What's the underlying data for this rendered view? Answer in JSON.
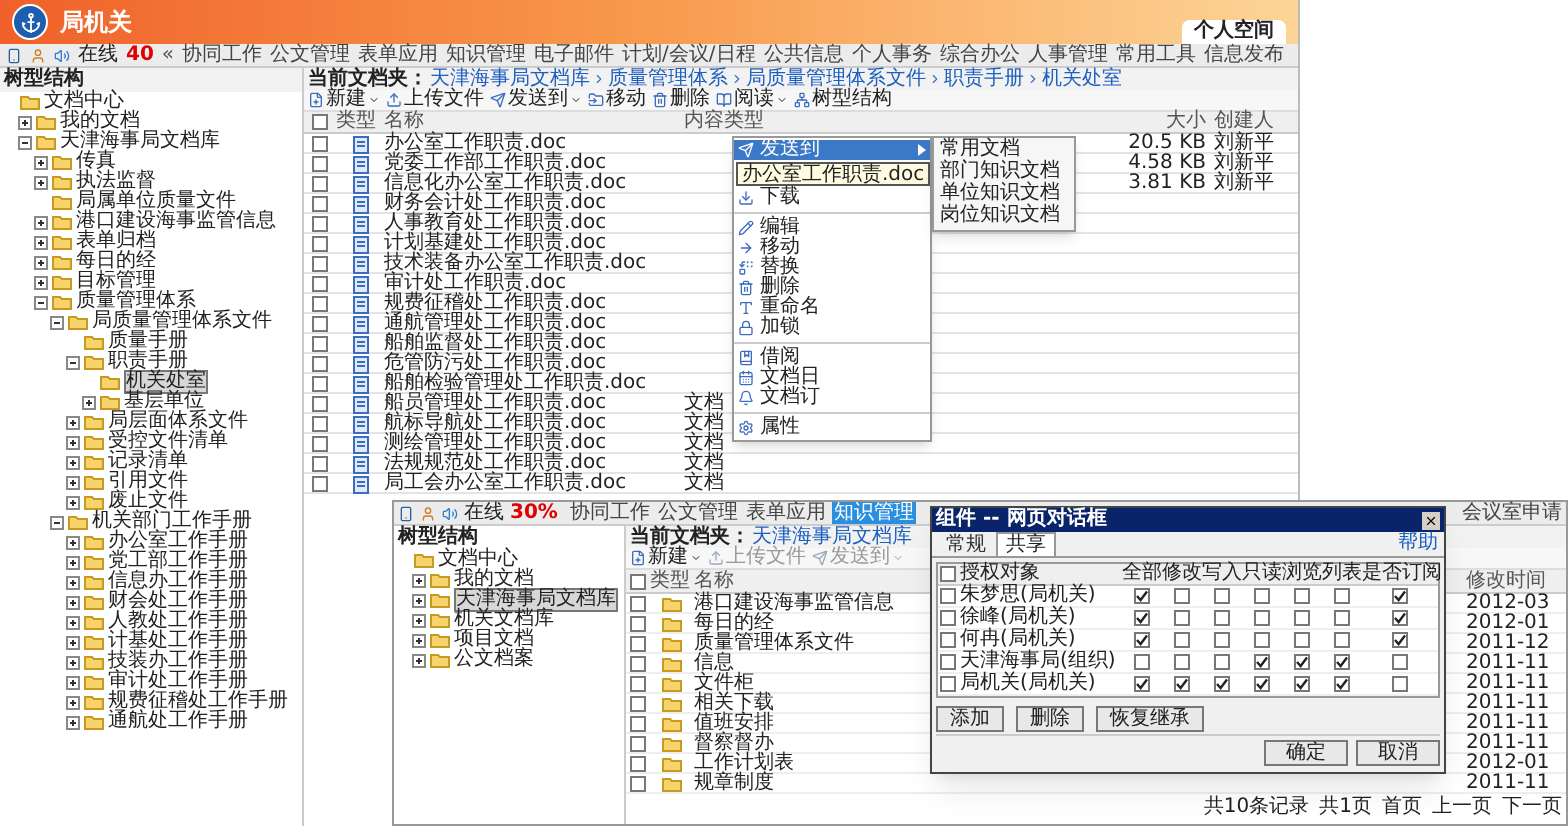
{
  "screen_a": {
    "title": "局机关",
    "personal_tab": "个人空间",
    "online": {
      "label": "在线",
      "count": "40"
    },
    "nav_more": "«",
    "nav": [
      "协同工作",
      "公文管理",
      "表单应用",
      "知识管理",
      "电子邮件",
      "计划/会议/日程",
      "公共信息",
      "个人事务",
      "综合办公",
      "人事管理",
      "常用工具",
      "信息发布"
    ],
    "tree_title": "树型结构",
    "tree": [
      {
        "label": "文档中心",
        "selected": false,
        "children": [
          {
            "label": "我的文档",
            "selected": false,
            "expanded": false
          },
          {
            "label": "天津海事局文档库",
            "selected": false,
            "expanded": true,
            "children": [
              {
                "label": "传真",
                "selected": false,
                "expanded": false
              },
              {
                "label": "执法监督",
                "selected": false,
                "expanded": false
              },
              {
                "label": "局属单位质量文件",
                "selected": false
              },
              {
                "label": "港口建设海事监管信息",
                "selected": false,
                "expanded": false
              },
              {
                "label": "表单归档",
                "selected": false,
                "expanded": false
              },
              {
                "label": "每日的经",
                "selected": false,
                "expanded": false
              },
              {
                "label": "目标管理",
                "selected": false,
                "expanded": false
              },
              {
                "label": "质量管理体系",
                "selected": false,
                "expanded": true,
                "children": [
                  {
                    "label": "局质量管理体系文件",
                    "selected": false,
                    "expanded": true,
                    "children": [
                      {
                        "label": "质量手册",
                        "selected": false
                      },
                      {
                        "label": "职责手册",
                        "selected": false,
                        "expanded": true,
                        "children": [
                          {
                            "label": "机关处室",
                            "selected": true
                          },
                          {
                            "label": "基层单位",
                            "selected": false,
                            "expanded": false
                          }
                        ]
                      },
                      {
                        "label": "局层面体系文件",
                        "selected": false,
                        "expanded": false
                      },
                      {
                        "label": "受控文件清单",
                        "selected": false,
                        "expanded": false
                      },
                      {
                        "label": "记录清单",
                        "selected": false,
                        "expanded": false
                      },
                      {
                        "label": "引用文件",
                        "selected": false,
                        "expanded": false
                      },
                      {
                        "label": "废止文件",
                        "selected": false,
                        "expanded": false
                      }
                    ]
                  },
                  {
                    "label": "机关部门工作手册",
                    "selected": false,
                    "expanded": true,
                    "children": [
                      {
                        "label": "办公室工作手册",
                        "selected": false,
                        "expanded": false
                      },
                      {
                        "label": "党工部工作手册",
                        "selected": false,
                        "expanded": false
                      },
                      {
                        "label": "信息办工作手册",
                        "selected": false,
                        "expanded": false
                      },
                      {
                        "label": "财会处工作手册",
                        "selected": false,
                        "expanded": false
                      },
                      {
                        "label": "人教处工作手册",
                        "selected": false,
                        "expanded": false
                      },
                      {
                        "label": "计基处工作手册",
                        "selected": false,
                        "expanded": false
                      },
                      {
                        "label": "技装办工作手册",
                        "selected": false,
                        "expanded": false
                      },
                      {
                        "label": "审计处工作手册",
                        "selected": false,
                        "expanded": false
                      },
                      {
                        "label": "规费征稽处工作手册",
                        "selected": false,
                        "expanded": false
                      },
                      {
                        "label": "通航处工作手册",
                        "selected": false,
                        "expanded": false
                      }
                    ]
                  }
                ]
              }
            ]
          }
        ]
      }
    ],
    "breadcrumb": {
      "label": "当前文档夹：",
      "path": [
        "天津海事局文档库",
        "质量管理体系",
        "局质量管理体系文件",
        "职责手册",
        "机关处室"
      ]
    },
    "toolbar": [
      {
        "label": "新建",
        "dropdown": true
      },
      {
        "label": "上传文件",
        "dropdown": false
      },
      {
        "label": "发送到",
        "dropdown": true
      },
      {
        "label": "移动",
        "dropdown": false
      },
      {
        "label": "删除",
        "dropdown": false
      },
      {
        "label": "阅读",
        "dropdown": true
      },
      {
        "label": "树型结构",
        "dropdown": false
      }
    ],
    "header_checked": false,
    "columns": [
      "类型",
      "名称",
      "内容类型",
      "大小",
      "创建人"
    ],
    "rows": [
      {
        "checked": false,
        "name": "办公室工作职责.doc",
        "size": "20.5 KB",
        "creator": "刘新平"
      },
      {
        "checked": false,
        "name": "党委工作部工作职责.doc",
        "size": "4.58 KB",
        "creator": "刘新平"
      },
      {
        "checked": false,
        "name": "信息化办公室工作职责.doc",
        "size": "3.81 KB",
        "creator": "刘新平"
      },
      {
        "checked": false,
        "name": "财务会计处工作职责.doc"
      },
      {
        "checked": false,
        "name": "人事教育处工作职责.doc"
      },
      {
        "checked": false,
        "name": "计划基建处工作职责.doc"
      },
      {
        "checked": false,
        "name": "技术装备办公室工作职责.doc"
      },
      {
        "checked": false,
        "name": "审计处工作职责.doc"
      },
      {
        "checked": false,
        "name": "规费征稽处工作职责.doc"
      },
      {
        "checked": false,
        "name": "通航管理处工作职责.doc"
      },
      {
        "checked": false,
        "name": "船舶监督处工作职责.doc"
      },
      {
        "checked": false,
        "name": "危管防污处工作职责.doc"
      },
      {
        "checked": false,
        "name": "船舶检验管理处工作职责.doc"
      },
      {
        "checked": false,
        "name": "船员管理处工作职责.doc",
        "content_type": "文档"
      },
      {
        "checked": false,
        "name": "航标导航处工作职责.doc",
        "content_type": "文档"
      },
      {
        "checked": false,
        "name": "测绘管理处工作职责.doc",
        "content_type": "文档"
      },
      {
        "checked": false,
        "name": "法规规范处工作职责.doc",
        "content_type": "文档"
      },
      {
        "checked": false,
        "name": "局工会办公室工作职责.doc",
        "content_type": "文档"
      }
    ],
    "context_menu": {
      "tooltip": "办公室工作职责.doc",
      "items": [
        {
          "kind": "item",
          "label": "发送到",
          "selected": true,
          "submenu": true
        },
        {
          "kind": "item",
          "label": "下载",
          "selected": false,
          "submenu": false
        },
        {
          "kind": "separator"
        },
        {
          "kind": "item",
          "label": "编辑",
          "selected": false,
          "submenu": false
        },
        {
          "kind": "item",
          "label": "移动",
          "selected": false,
          "submenu": false
        },
        {
          "kind": "item",
          "label": "替换",
          "selected": false,
          "submenu": false
        },
        {
          "kind": "item",
          "label": "删除",
          "selected": false,
          "submenu": false
        },
        {
          "kind": "item",
          "label": "重命名",
          "selected": false,
          "submenu": false
        },
        {
          "kind": "item",
          "label": "加锁",
          "selected": false,
          "submenu": false
        },
        {
          "kind": "separator"
        },
        {
          "kind": "item",
          "label": "借阅",
          "selected": false,
          "submenu": false
        },
        {
          "kind": "item",
          "label": "文档日",
          "selected": false,
          "submenu": false
        },
        {
          "kind": "item",
          "label": "文档订",
          "selected": false,
          "submenu": false
        },
        {
          "kind": "separator"
        },
        {
          "kind": "item",
          "label": "属性",
          "selected": false,
          "submenu": false
        }
      ],
      "submenu": [
        "常用文档",
        "部门知识文档",
        "单位知识文档",
        "岗位知识文档"
      ]
    }
  },
  "screen_b": {
    "online": {
      "label": "在线",
      "count": "30%"
    },
    "nav": [
      {
        "label": "协同工作",
        "selected": false
      },
      {
        "label": "公文管理",
        "selected": false
      },
      {
        "label": "表单应用",
        "selected": false
      },
      {
        "label": "知识管理",
        "selected": true
      }
    ],
    "nav_right": "会议室申请",
    "tree_title": "树型结构",
    "tree": [
      {
        "label": "文档中心",
        "selected": false,
        "children": [
          {
            "label": "我的文档",
            "selected": false,
            "expanded": false
          },
          {
            "label": "天津海事局文档库",
            "selected": true,
            "expanded": false
          },
          {
            "label": "机关文档库",
            "selected": false,
            "expanded": false
          },
          {
            "label": "项目文档",
            "selected": false,
            "expanded": false
          },
          {
            "label": "公文档案",
            "selected": false,
            "expanded": false
          }
        ]
      }
    ],
    "breadcrumb": {
      "label": "当前文档夹：",
      "path": [
        "天津海事局文档库"
      ]
    },
    "toolbar": [
      {
        "label": "新建",
        "dropdown": true,
        "disabled": false
      },
      {
        "label": "上传文件",
        "dropdown": false,
        "disabled": true
      },
      {
        "label": "发送到",
        "dropdown": true,
        "disabled": true
      }
    ],
    "header_checked": false,
    "columns": [
      "类型",
      "名称",
      "修改时间"
    ],
    "rows": [
      {
        "checked": false,
        "name": "港口建设海事监管信息",
        "modified": "2012-03"
      },
      {
        "checked": false,
        "name": "每日的经",
        "modified": "2012-01"
      },
      {
        "checked": false,
        "name": "质量管理体系文件",
        "modified": "2011-12"
      },
      {
        "checked": false,
        "name": "信息",
        "modified": "2011-11"
      },
      {
        "checked": false,
        "name": "文件柜",
        "modified": "2011-11"
      },
      {
        "checked": false,
        "name": "相关下载",
        "modified": "2011-11"
      },
      {
        "checked": false,
        "name": "值班安排",
        "modified": "2011-11"
      },
      {
        "checked": false,
        "name": "督察督办",
        "modified": "2011-11"
      },
      {
        "checked": false,
        "name": "工作计划表",
        "modified": "2012-01"
      },
      {
        "checked": false,
        "name": "规章制度",
        "modified": "2011-11"
      }
    ],
    "pager": [
      "共10条记录",
      "共1页",
      "首页",
      "上一页",
      "下一页"
    ],
    "dialog": {
      "title": "组件 -- 网页对话框",
      "tabs": [
        {
          "label": "常规",
          "selected": false
        },
        {
          "label": "共享",
          "selected": true
        }
      ],
      "help": "帮助",
      "header_checked": false,
      "columns": [
        "授权对象",
        "全部",
        "修改",
        "写入",
        "只读",
        "浏览",
        "列表",
        "是否订阅"
      ],
      "rows": [
        {
          "name": "朱梦思(局机关)",
          "checked": false,
          "permissions": [
            true,
            false,
            false,
            false,
            false,
            false,
            true
          ]
        },
        {
          "name": "徐峰(局机关)",
          "checked": false,
          "permissions": [
            true,
            false,
            false,
            false,
            false,
            false,
            true
          ]
        },
        {
          "name": "何冉(局机关)",
          "checked": false,
          "permissions": [
            true,
            false,
            false,
            false,
            false,
            false,
            true
          ]
        },
        {
          "name": "天津海事局(组织)",
          "checked": false,
          "permissions": [
            false,
            false,
            false,
            true,
            true,
            true,
            false
          ]
        },
        {
          "name": "局机关(局机关)",
          "checked": false,
          "permissions": [
            true,
            true,
            true,
            true,
            true,
            true,
            false
          ]
        }
      ],
      "actions": [
        "添加",
        "删除",
        "恢复继承"
      ],
      "buttons": [
        "确定",
        "取消"
      ]
    }
  }
}
